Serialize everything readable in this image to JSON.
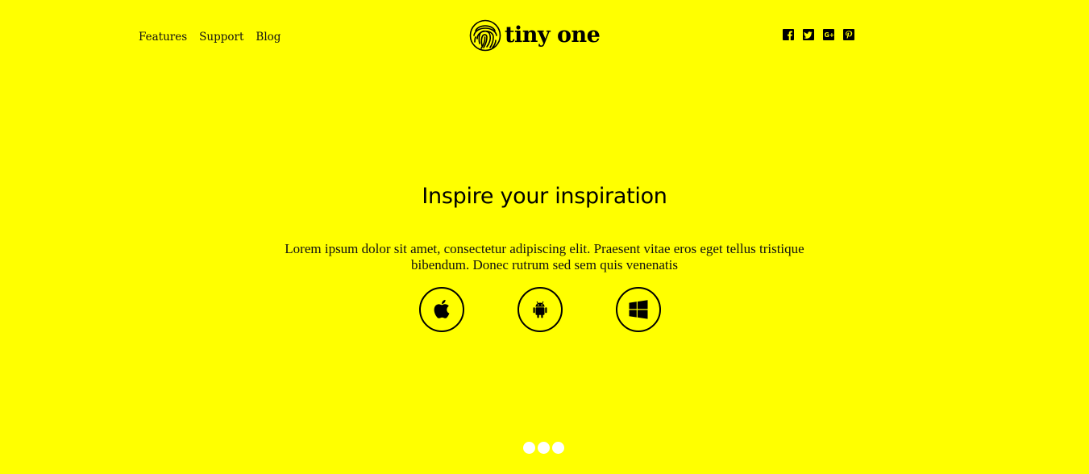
{
  "colors": {
    "background": "#ffff00",
    "text": "#111111",
    "dot": "#ffffff"
  },
  "header": {
    "nav": [
      {
        "label": "Features"
      },
      {
        "label": "Support"
      },
      {
        "label": "Blog"
      }
    ],
    "logo": {
      "icon": "fingerprint-icon",
      "text": "tiny one"
    },
    "social": [
      "facebook-icon",
      "twitter-icon",
      "google-plus-icon",
      "pinterest-icon"
    ]
  },
  "hero": {
    "title": "Inspire your inspiration",
    "text": "Lorem ipsum dolor sit amet, consectetur adipiscing elit. Praesent vitae eros eget tellus tristique bibendum. Donec rutrum sed sem quis venenatis",
    "platforms": [
      "apple-icon",
      "android-icon",
      "windows-icon"
    ]
  },
  "slider": {
    "dot_count": 3
  }
}
